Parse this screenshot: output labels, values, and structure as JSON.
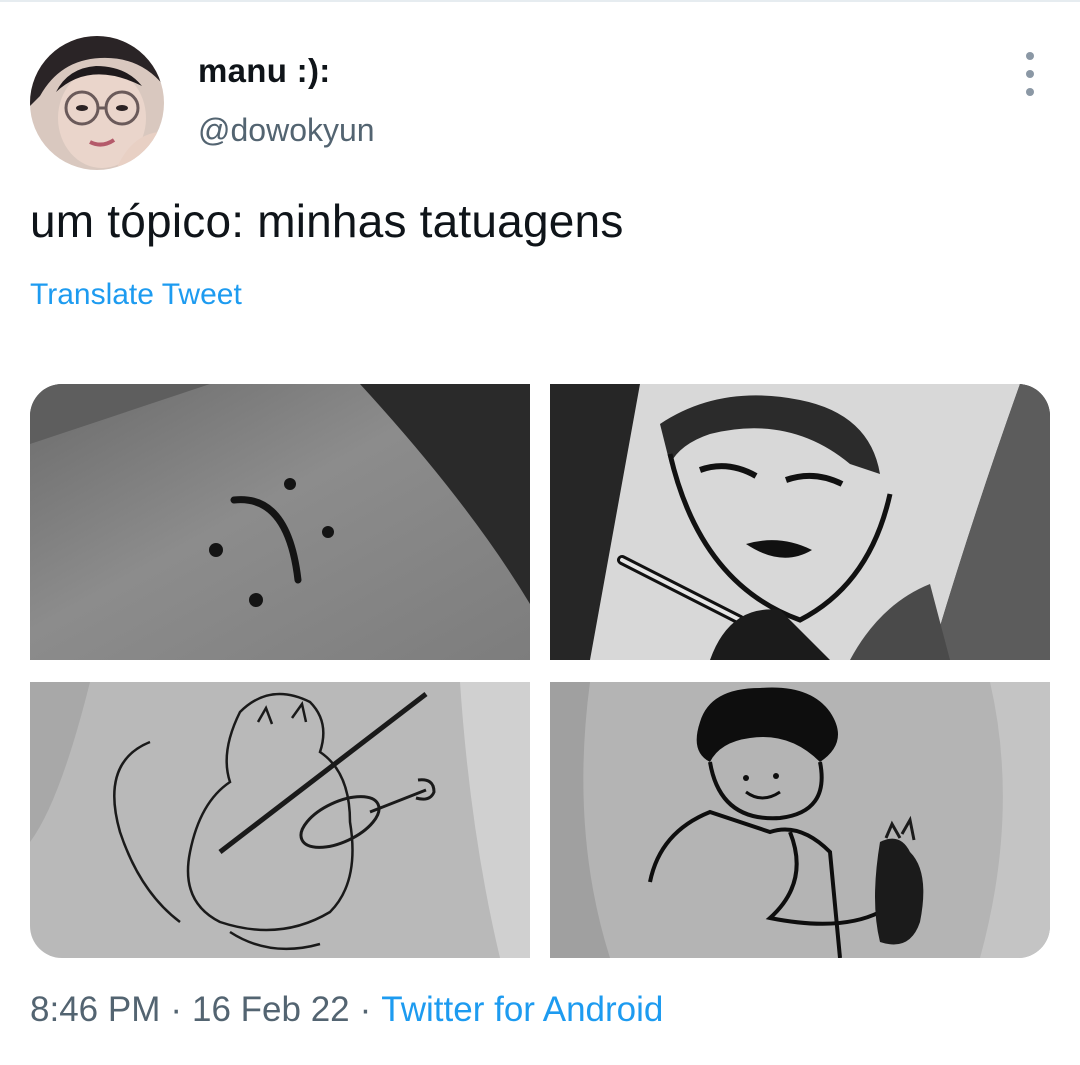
{
  "tweet": {
    "display_name": "manu :):",
    "handle": "@dowokyun",
    "text": "um tópico: minhas tatuagens",
    "translate_label": "Translate Tweet",
    "time": "8:46 PM",
    "separator": "·",
    "date": "16 Feb 22",
    "source": "Twitter for Android"
  },
  "media": [
    {
      "subject": "sad face tattoo"
    },
    {
      "subject": "anime man tattoo"
    },
    {
      "subject": "cat playing violin tattoo"
    },
    {
      "subject": "person with cat tattoo"
    }
  ],
  "icons": {
    "more": "more-vertical-icon"
  },
  "colors": {
    "link": "#1d9bf0",
    "secondary_text": "#536471",
    "primary_text": "#0f1419"
  }
}
